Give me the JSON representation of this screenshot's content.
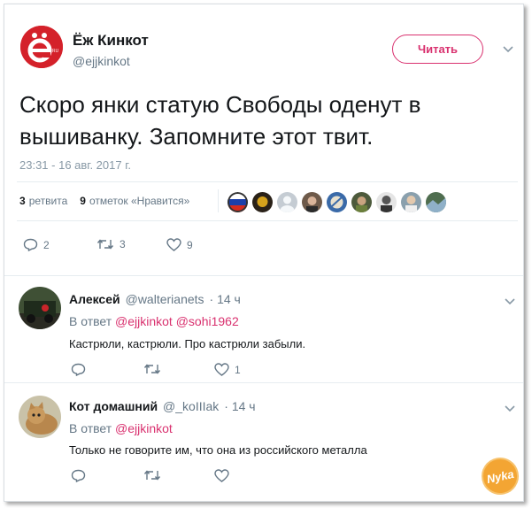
{
  "tweet": {
    "author_name": "Ёж Кинкот",
    "author_handle": "@ejjkinkot",
    "follow_label": "Читать",
    "text": "Скоро янки статую Свободы оденут в вышиванку. Запомните этот твит.",
    "timestamp": "23:31 - 16 авг. 2017 г.",
    "retweets_count": "3",
    "retweets_label": "ретвита",
    "likes_count": "9",
    "likes_label": "отметок «Нравится»",
    "actions": {
      "replies": "2",
      "retweets": "3",
      "likes": "9"
    }
  },
  "replies": [
    {
      "name": "Алексей",
      "handle": "@walterianets",
      "time": "· 14 ч",
      "in_reply_prefix": "В ответ",
      "in_reply_to": [
        "@ejjkinkot",
        "@sohi1962"
      ],
      "text": "Кастрюли, кастрюли. Про кастрюли забыли.",
      "actions": {
        "replies": "",
        "retweets": "",
        "likes": "1"
      }
    },
    {
      "name": "Кот домашний",
      "handle": "@_koIIIak",
      "time": "· 14 ч",
      "in_reply_prefix": "В ответ",
      "in_reply_to": [
        "@ejjkinkot"
      ],
      "text": "Только не говорите им, что она из российского металла",
      "actions": {
        "replies": "",
        "retweets": "",
        "likes": ""
      }
    }
  ],
  "watermark": "Nyka",
  "colors": {
    "accent": "#d9316f",
    "text": "#14171a",
    "muted": "#657786",
    "divider": "#e6ecf0"
  }
}
